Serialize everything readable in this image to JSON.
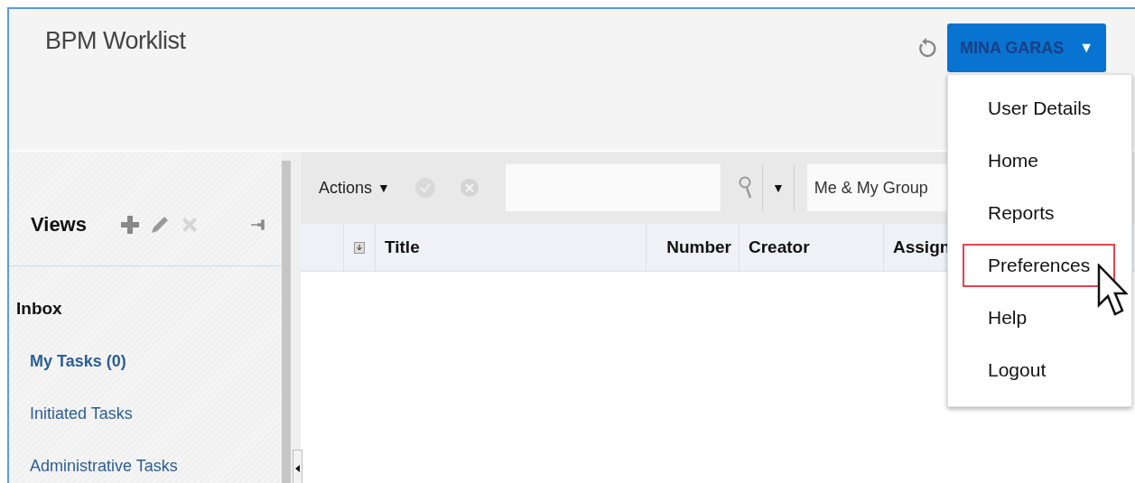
{
  "app": {
    "title": "BPM Worklist"
  },
  "user_menu": {
    "name": "MINA GARAS",
    "caret": "▼",
    "items": [
      {
        "label": "User Details",
        "selected": false
      },
      {
        "label": "Home",
        "selected": false
      },
      {
        "label": "Reports",
        "selected": false
      },
      {
        "label": "Preferences",
        "selected": true
      },
      {
        "label": "Help",
        "selected": false
      },
      {
        "label": "Logout",
        "selected": false
      }
    ]
  },
  "views": {
    "title": "Views",
    "sections": [
      {
        "label": "Inbox",
        "items": [
          {
            "label": "My Tasks (0)",
            "selected": true
          },
          {
            "label": "Initiated Tasks",
            "selected": false
          },
          {
            "label": "Administrative Tasks",
            "selected": false
          }
        ]
      }
    ]
  },
  "toolbar": {
    "actions": "Actions",
    "actions_caret": "▼",
    "search_caret": "▼",
    "assignee_filter": "Me & My Group"
  },
  "table": {
    "columns": [
      {
        "label": "Title",
        "kind": "text"
      },
      {
        "label": "Number",
        "kind": "number"
      },
      {
        "label": "Creator",
        "kind": "text"
      },
      {
        "label": "Assign",
        "kind": "text"
      }
    ]
  }
}
